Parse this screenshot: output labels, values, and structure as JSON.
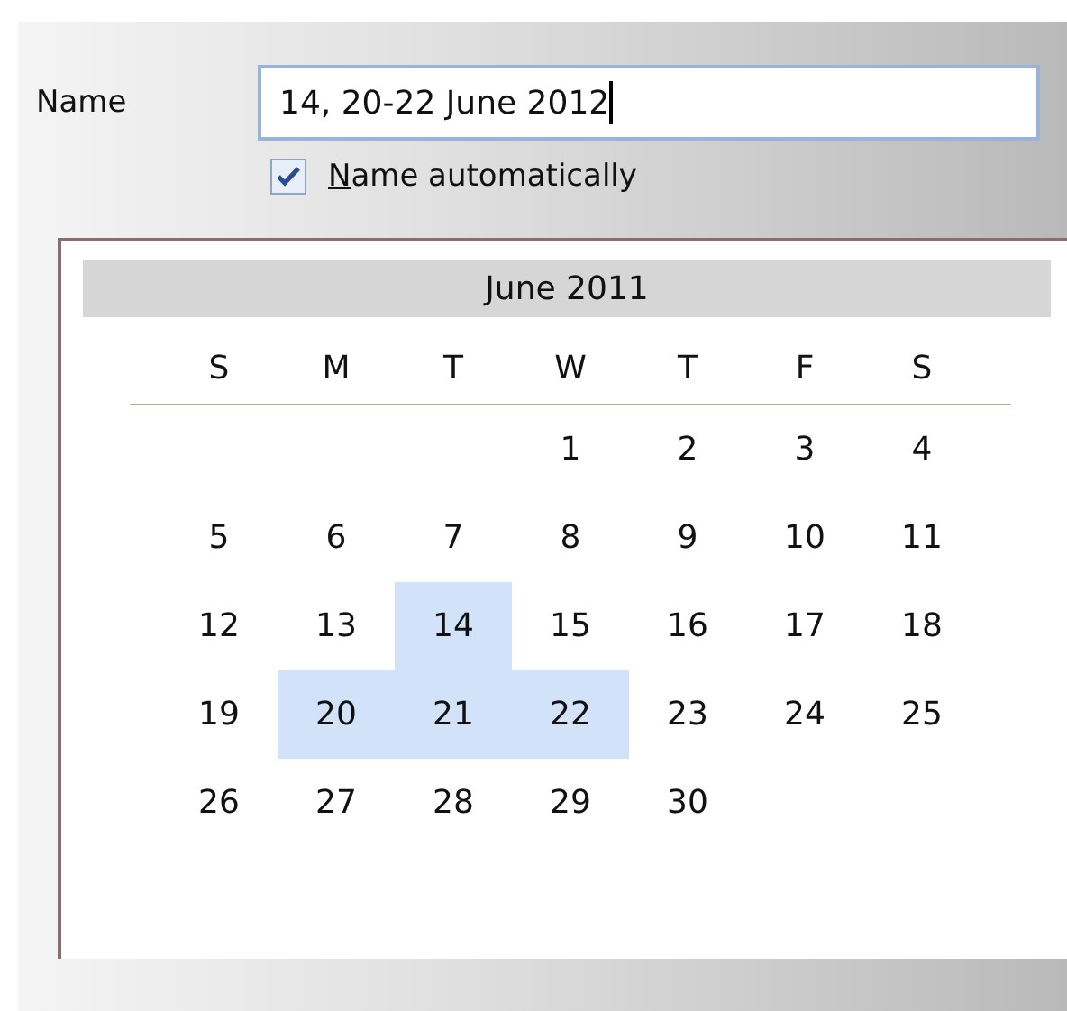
{
  "name_field": {
    "label": "Name",
    "value": "14, 20-22 June 2012",
    "focused": true
  },
  "auto_name": {
    "label": "Name automatically",
    "checked": true
  },
  "calendar": {
    "month": "June 2011",
    "weekdays": [
      "S",
      "M",
      "T",
      "W",
      "T",
      "F",
      "S"
    ],
    "weeks": [
      {
        "kind": "first",
        "days": [
          {
            "day": "1",
            "selected": false
          },
          {
            "day": "2",
            "selected": false
          },
          {
            "day": "3",
            "selected": false
          },
          {
            "day": "4",
            "selected": false
          }
        ]
      },
      {
        "kind": "full",
        "days": [
          {
            "day": "5",
            "selected": false
          },
          {
            "day": "6",
            "selected": false
          },
          {
            "day": "7",
            "selected": false
          },
          {
            "day": "8",
            "selected": false
          },
          {
            "day": "9",
            "selected": false
          },
          {
            "day": "10",
            "selected": false
          },
          {
            "day": "11",
            "selected": false
          }
        ]
      },
      {
        "kind": "full",
        "days": [
          {
            "day": "12",
            "selected": false
          },
          {
            "day": "13",
            "selected": false
          },
          {
            "day": "14",
            "selected": true
          },
          {
            "day": "15",
            "selected": false
          },
          {
            "day": "16",
            "selected": false
          },
          {
            "day": "17",
            "selected": false
          },
          {
            "day": "18",
            "selected": false
          }
        ]
      },
      {
        "kind": "full",
        "days": [
          {
            "day": "19",
            "selected": false
          },
          {
            "day": "20",
            "selected": true
          },
          {
            "day": "21",
            "selected": true
          },
          {
            "day": "22",
            "selected": true
          },
          {
            "day": "23",
            "selected": false
          },
          {
            "day": "24",
            "selected": false
          },
          {
            "day": "25",
            "selected": false
          }
        ]
      },
      {
        "kind": "last",
        "days": [
          {
            "day": "26",
            "selected": false
          },
          {
            "day": "27",
            "selected": false
          },
          {
            "day": "28",
            "selected": false
          },
          {
            "day": "29",
            "selected": false
          },
          {
            "day": "30",
            "selected": false
          }
        ]
      }
    ]
  }
}
